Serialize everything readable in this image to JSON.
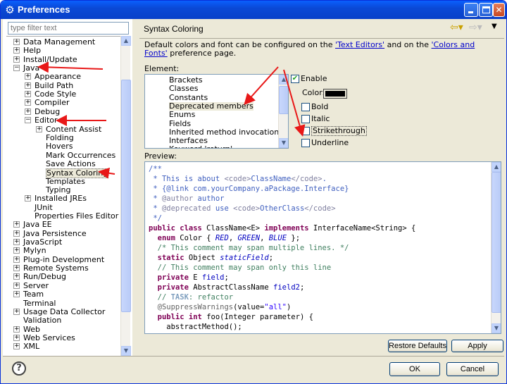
{
  "window": {
    "title": "Preferences",
    "minimize_label": "_",
    "maximize_label": "",
    "close_label": "✕"
  },
  "left": {
    "filter_placeholder": "type filter text",
    "tree": [
      {
        "label": "Data Management",
        "level": 0,
        "expander": "+"
      },
      {
        "label": "Help",
        "level": 0,
        "expander": "+"
      },
      {
        "label": "Install/Update",
        "level": 0,
        "expander": "+"
      },
      {
        "label": "Java",
        "level": 0,
        "expander": "-"
      },
      {
        "label": "Appearance",
        "level": 1,
        "expander": "+"
      },
      {
        "label": "Build Path",
        "level": 1,
        "expander": "+"
      },
      {
        "label": "Code Style",
        "level": 1,
        "expander": "+"
      },
      {
        "label": "Compiler",
        "level": 1,
        "expander": "+"
      },
      {
        "label": "Debug",
        "level": 1,
        "expander": "+"
      },
      {
        "label": "Editor",
        "level": 1,
        "expander": "-"
      },
      {
        "label": "Content Assist",
        "level": 2,
        "expander": "+"
      },
      {
        "label": "Folding",
        "level": 2,
        "expander": ""
      },
      {
        "label": "Hovers",
        "level": 2,
        "expander": ""
      },
      {
        "label": "Mark Occurrences",
        "level": 2,
        "expander": ""
      },
      {
        "label": "Save Actions",
        "level": 2,
        "expander": ""
      },
      {
        "label": "Syntax Coloring",
        "level": 2,
        "expander": "",
        "selected": true
      },
      {
        "label": "Templates",
        "level": 2,
        "expander": ""
      },
      {
        "label": "Typing",
        "level": 2,
        "expander": ""
      },
      {
        "label": "Installed JREs",
        "level": 1,
        "expander": "+"
      },
      {
        "label": "JUnit",
        "level": 1,
        "expander": ""
      },
      {
        "label": "Properties Files Editor",
        "level": 1,
        "expander": ""
      },
      {
        "label": "Java EE",
        "level": 0,
        "expander": "+"
      },
      {
        "label": "Java Persistence",
        "level": 0,
        "expander": "+"
      },
      {
        "label": "JavaScript",
        "level": 0,
        "expander": "+"
      },
      {
        "label": "Mylyn",
        "level": 0,
        "expander": "+"
      },
      {
        "label": "Plug-in Development",
        "level": 0,
        "expander": "+"
      },
      {
        "label": "Remote Systems",
        "level": 0,
        "expander": "+"
      },
      {
        "label": "Run/Debug",
        "level": 0,
        "expander": "+"
      },
      {
        "label": "Server",
        "level": 0,
        "expander": "+"
      },
      {
        "label": "Team",
        "level": 0,
        "expander": "+"
      },
      {
        "label": "Terminal",
        "level": 0,
        "expander": ""
      },
      {
        "label": "Usage Data Collector",
        "level": 0,
        "expander": "+"
      },
      {
        "label": "Validation",
        "level": 0,
        "expander": ""
      },
      {
        "label": "Web",
        "level": 0,
        "expander": "+"
      },
      {
        "label": "Web Services",
        "level": 0,
        "expander": "+"
      },
      {
        "label": "XML",
        "level": 0,
        "expander": "+"
      }
    ]
  },
  "right": {
    "title": "Syntax Coloring",
    "description_prefix": "Default colors and font can be configured on the ",
    "link_text_editors": "'Text Editors'",
    "description_middle": " and on the ",
    "link_colors_fonts": "'Colors and Fonts'",
    "description_suffix": " preference page.",
    "element_label": "Element:",
    "elements": [
      {
        "label": "Brackets"
      },
      {
        "label": "Classes"
      },
      {
        "label": "Constants"
      },
      {
        "label": "Deprecated members",
        "selected": true
      },
      {
        "label": "Enums"
      },
      {
        "label": "Fields"
      },
      {
        "label": "Inherited method invocations"
      },
      {
        "label": "Interfaces"
      },
      {
        "label": "Keyword 'return'"
      }
    ],
    "enable_label": "Enable",
    "enable_checked": true,
    "color_label": "Color:",
    "color_value": "#000000",
    "bold_label": "Bold",
    "italic_label": "Italic",
    "strikethrough_label": "Strikethrough",
    "underline_label": "Underline",
    "preview_label": "Preview:",
    "restore_label": "Restore Defaults",
    "apply_label": "Apply"
  },
  "bottom": {
    "help_label": "?",
    "ok_label": "OK",
    "cancel_label": "Cancel"
  },
  "code": [
    [
      {
        "t": "/**",
        "c": "c-jdoc"
      }
    ],
    [
      {
        "t": " * This is about ",
        "c": "c-jdoc"
      },
      {
        "t": "<code>",
        "c": "c-tag"
      },
      {
        "t": "ClassName",
        "c": "c-jdoc"
      },
      {
        "t": "</code>",
        "c": "c-tag"
      },
      {
        "t": ".",
        "c": "c-jdoc"
      }
    ],
    [
      {
        "t": " * {@link com.yourCompany.aPackage.Interface}",
        "c": "c-jdoc"
      }
    ],
    [
      {
        "t": " * ",
        "c": "c-jdoc"
      },
      {
        "t": "@author",
        "c": "c-tag"
      },
      {
        "t": " author",
        "c": "c-jdoc"
      }
    ],
    [
      {
        "t": " * ",
        "c": "c-jdoc"
      },
      {
        "t": "@deprecated",
        "c": "c-tag"
      },
      {
        "t": " use ",
        "c": "c-jdoc"
      },
      {
        "t": "<code>",
        "c": "c-tag"
      },
      {
        "t": "OtherClass",
        "c": "c-jdoc"
      },
      {
        "t": "</code>",
        "c": "c-tag"
      }
    ],
    [
      {
        "t": " */",
        "c": "c-jdoc"
      }
    ],
    [
      {
        "t": "public class",
        "c": "c-kw"
      },
      {
        "t": " ClassName<E> ",
        "c": ""
      },
      {
        "t": "implements",
        "c": "c-kw"
      },
      {
        "t": " InterfaceName<String> {",
        "c": ""
      }
    ],
    [
      {
        "t": "  ",
        "c": ""
      },
      {
        "t": "enum",
        "c": "c-kw"
      },
      {
        "t": " Color { ",
        "c": ""
      },
      {
        "t": "RED",
        "c": "c-field c-it"
      },
      {
        "t": ", ",
        "c": ""
      },
      {
        "t": "GREEN",
        "c": "c-field c-it"
      },
      {
        "t": ", ",
        "c": ""
      },
      {
        "t": "BLUE",
        "c": "c-field c-it"
      },
      {
        "t": " };",
        "c": ""
      }
    ],
    [
      {
        "t": "  /* This comment may span multiple lines. */",
        "c": "c-cmt"
      }
    ],
    [
      {
        "t": "  ",
        "c": ""
      },
      {
        "t": "static",
        "c": "c-kw"
      },
      {
        "t": " Object ",
        "c": ""
      },
      {
        "t": "staticField",
        "c": "c-field c-it"
      },
      {
        "t": ";",
        "c": ""
      }
    ],
    [
      {
        "t": "  // This comment may span only this line",
        "c": "c-cmt"
      }
    ],
    [
      {
        "t": "  ",
        "c": ""
      },
      {
        "t": "private",
        "c": "c-kw"
      },
      {
        "t": " E ",
        "c": ""
      },
      {
        "t": "field",
        "c": "c-field"
      },
      {
        "t": ";",
        "c": ""
      }
    ],
    [
      {
        "t": "  ",
        "c": ""
      },
      {
        "t": "private",
        "c": "c-kw"
      },
      {
        "t": " AbstractClassName ",
        "c": ""
      },
      {
        "t": "field2",
        "c": "c-field"
      },
      {
        "t": ";",
        "c": ""
      }
    ],
    [
      {
        "t": "  // ",
        "c": "c-cmt"
      },
      {
        "t": "TASK",
        "c": "c-task"
      },
      {
        "t": ": refactor",
        "c": "c-cmt"
      }
    ],
    [
      {
        "t": "  @SuppressWarnings",
        "c": "c-ann"
      },
      {
        "t": "(value=",
        "c": ""
      },
      {
        "t": "\"all\"",
        "c": "c-str"
      },
      {
        "t": ")",
        "c": ""
      }
    ],
    [
      {
        "t": "  ",
        "c": ""
      },
      {
        "t": "public int",
        "c": "c-kw"
      },
      {
        "t": " foo(Integer parameter) {",
        "c": ""
      }
    ],
    [
      {
        "t": "    abstractMethod();",
        "c": ""
      }
    ]
  ]
}
